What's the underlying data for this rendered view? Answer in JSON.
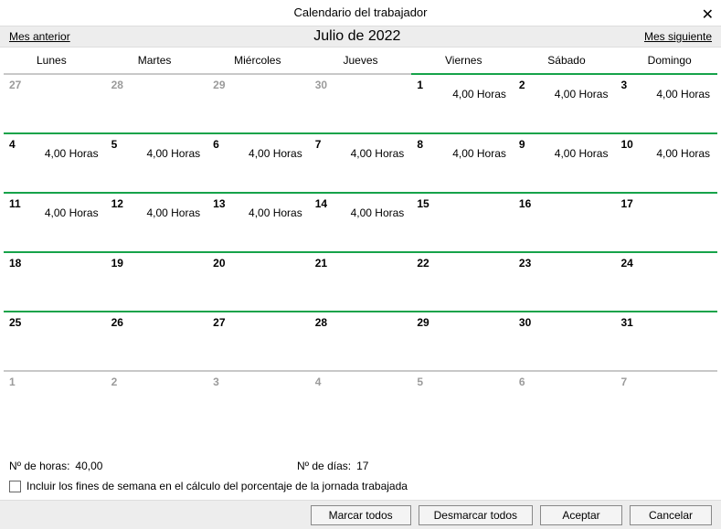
{
  "dialog": {
    "title": "Calendario del trabajador",
    "close": "✕"
  },
  "nav": {
    "prev": "Mes anterior",
    "next": "Mes siguiente",
    "month": "Julio de 2022"
  },
  "dow": [
    "Lunes",
    "Martes",
    "Miércoles",
    "Jueves",
    "Viernes",
    "Sábado",
    "Domingo"
  ],
  "hours_text": "4,00 Horas",
  "weeks": [
    [
      {
        "n": "27",
        "muted": true,
        "active": false,
        "hours": false
      },
      {
        "n": "28",
        "muted": true,
        "active": false,
        "hours": false
      },
      {
        "n": "29",
        "muted": true,
        "active": false,
        "hours": false
      },
      {
        "n": "30",
        "muted": true,
        "active": false,
        "hours": false
      },
      {
        "n": "1",
        "muted": false,
        "active": true,
        "hours": true
      },
      {
        "n": "2",
        "muted": false,
        "active": true,
        "hours": true
      },
      {
        "n": "3",
        "muted": false,
        "active": true,
        "hours": true
      }
    ],
    [
      {
        "n": "4",
        "muted": false,
        "active": true,
        "hours": true
      },
      {
        "n": "5",
        "muted": false,
        "active": true,
        "hours": true
      },
      {
        "n": "6",
        "muted": false,
        "active": true,
        "hours": true
      },
      {
        "n": "7",
        "muted": false,
        "active": true,
        "hours": true
      },
      {
        "n": "8",
        "muted": false,
        "active": true,
        "hours": true
      },
      {
        "n": "9",
        "muted": false,
        "active": true,
        "hours": true
      },
      {
        "n": "10",
        "muted": false,
        "active": true,
        "hours": true
      }
    ],
    [
      {
        "n": "11",
        "muted": false,
        "active": true,
        "hours": true
      },
      {
        "n": "12",
        "muted": false,
        "active": true,
        "hours": true
      },
      {
        "n": "13",
        "muted": false,
        "active": true,
        "hours": true
      },
      {
        "n": "14",
        "muted": false,
        "active": true,
        "hours": true
      },
      {
        "n": "15",
        "muted": false,
        "active": true,
        "hours": false
      },
      {
        "n": "16",
        "muted": false,
        "active": true,
        "hours": false
      },
      {
        "n": "17",
        "muted": false,
        "active": true,
        "hours": false
      }
    ],
    [
      {
        "n": "18",
        "muted": false,
        "active": true,
        "hours": false
      },
      {
        "n": "19",
        "muted": false,
        "active": true,
        "hours": false
      },
      {
        "n": "20",
        "muted": false,
        "active": true,
        "hours": false
      },
      {
        "n": "21",
        "muted": false,
        "active": true,
        "hours": false
      },
      {
        "n": "22",
        "muted": false,
        "active": true,
        "hours": false
      },
      {
        "n": "23",
        "muted": false,
        "active": true,
        "hours": false
      },
      {
        "n": "24",
        "muted": false,
        "active": true,
        "hours": false
      }
    ],
    [
      {
        "n": "25",
        "muted": false,
        "active": true,
        "hours": false
      },
      {
        "n": "26",
        "muted": false,
        "active": true,
        "hours": false
      },
      {
        "n": "27",
        "muted": false,
        "active": true,
        "hours": false
      },
      {
        "n": "28",
        "muted": false,
        "active": true,
        "hours": false
      },
      {
        "n": "29",
        "muted": false,
        "active": true,
        "hours": false
      },
      {
        "n": "30",
        "muted": false,
        "active": true,
        "hours": false
      },
      {
        "n": "31",
        "muted": false,
        "active": true,
        "hours": false
      }
    ],
    [
      {
        "n": "1",
        "muted": true,
        "active": false,
        "hours": false
      },
      {
        "n": "2",
        "muted": true,
        "active": false,
        "hours": false
      },
      {
        "n": "3",
        "muted": true,
        "active": false,
        "hours": false
      },
      {
        "n": "4",
        "muted": true,
        "active": false,
        "hours": false
      },
      {
        "n": "5",
        "muted": true,
        "active": false,
        "hours": false
      },
      {
        "n": "6",
        "muted": true,
        "active": false,
        "hours": false
      },
      {
        "n": "7",
        "muted": true,
        "active": false,
        "hours": false
      }
    ]
  ],
  "summary": {
    "hours_label": "Nº de horas:",
    "hours_value": "40,00",
    "days_label": "Nº de días:",
    "days_value": "17"
  },
  "checkbox": {
    "label": "Incluir los fines de semana en el cálculo del porcentaje de la jornada trabajada",
    "checked": false
  },
  "buttons": {
    "mark_all": "Marcar todos",
    "unmark_all": "Desmarcar todos",
    "accept": "Aceptar",
    "cancel": "Cancelar"
  }
}
